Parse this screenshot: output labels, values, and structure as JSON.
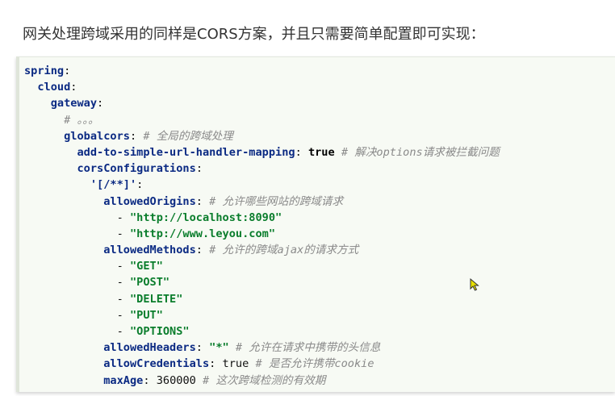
{
  "intro_text": "网关处理跨域采用的同样是CORS方案，并且只需要简单配置即可实现：",
  "code_lines": [
    {
      "indent": "",
      "parts": [
        {
          "t": "spring",
          "c": "k"
        },
        {
          "t": ":",
          "c": "v"
        }
      ]
    },
    {
      "indent": "  ",
      "parts": [
        {
          "t": "cloud",
          "c": "k"
        },
        {
          "t": ":",
          "c": "v"
        }
      ]
    },
    {
      "indent": "    ",
      "parts": [
        {
          "t": "gateway",
          "c": "k"
        },
        {
          "t": ":",
          "c": "v"
        }
      ]
    },
    {
      "indent": "      ",
      "parts": [
        {
          "t": "# 。。。",
          "c": "c"
        }
      ]
    },
    {
      "indent": "      ",
      "parts": [
        {
          "t": "globalcors",
          "c": "k"
        },
        {
          "t": ": ",
          "c": "v"
        },
        {
          "t": "# 全局的跨域处理",
          "c": "c"
        }
      ]
    },
    {
      "indent": "        ",
      "parts": [
        {
          "t": "add-to-simple-url-handler-mapping",
          "c": "k"
        },
        {
          "t": ": ",
          "c": "v"
        },
        {
          "t": "true",
          "c": "b"
        },
        {
          "t": " # 解决options请求被拦截问题",
          "c": "c"
        }
      ]
    },
    {
      "indent": "        ",
      "parts": [
        {
          "t": "corsConfigurations",
          "c": "k"
        },
        {
          "t": ":",
          "c": "v"
        }
      ]
    },
    {
      "indent": "          ",
      "parts": [
        {
          "t": "'[/**]'",
          "c": "k"
        },
        {
          "t": ":",
          "c": "v"
        }
      ]
    },
    {
      "indent": "            ",
      "parts": [
        {
          "t": "allowedOrigins",
          "c": "k"
        },
        {
          "t": ": ",
          "c": "v"
        },
        {
          "t": "# 允许哪些网站的跨域请求",
          "c": "c"
        }
      ]
    },
    {
      "indent": "              ",
      "parts": [
        {
          "t": "- ",
          "c": "v"
        },
        {
          "t": "\"http://localhost:8090\"",
          "c": "s"
        }
      ]
    },
    {
      "indent": "              ",
      "parts": [
        {
          "t": "- ",
          "c": "v"
        },
        {
          "t": "\"http://www.leyou.com\"",
          "c": "s"
        }
      ]
    },
    {
      "indent": "            ",
      "parts": [
        {
          "t": "allowedMethods",
          "c": "k"
        },
        {
          "t": ": ",
          "c": "v"
        },
        {
          "t": "# 允许的跨域ajax的请求方式",
          "c": "c"
        }
      ]
    },
    {
      "indent": "              ",
      "parts": [
        {
          "t": "- ",
          "c": "v"
        },
        {
          "t": "\"GET\"",
          "c": "s"
        }
      ]
    },
    {
      "indent": "              ",
      "parts": [
        {
          "t": "- ",
          "c": "v"
        },
        {
          "t": "\"POST\"",
          "c": "s"
        }
      ]
    },
    {
      "indent": "              ",
      "parts": [
        {
          "t": "- ",
          "c": "v"
        },
        {
          "t": "\"DELETE\"",
          "c": "s"
        }
      ]
    },
    {
      "indent": "              ",
      "parts": [
        {
          "t": "- ",
          "c": "v"
        },
        {
          "t": "\"PUT\"",
          "c": "s"
        }
      ]
    },
    {
      "indent": "              ",
      "parts": [
        {
          "t": "- ",
          "c": "v"
        },
        {
          "t": "\"OPTIONS\"",
          "c": "s"
        }
      ]
    },
    {
      "indent": "            ",
      "parts": [
        {
          "t": "allowedHeaders",
          "c": "k"
        },
        {
          "t": ": ",
          "c": "v"
        },
        {
          "t": "\"*\"",
          "c": "s"
        },
        {
          "t": " # 允许在请求中携带的头信息",
          "c": "c"
        }
      ]
    },
    {
      "indent": "            ",
      "parts": [
        {
          "t": "allowCredentials",
          "c": "k"
        },
        {
          "t": ": ",
          "c": "v"
        },
        {
          "t": "true",
          "c": "v"
        },
        {
          "t": " # 是否允许携带cookie",
          "c": "c"
        }
      ]
    },
    {
      "indent": "            ",
      "parts": [
        {
          "t": "maxAge",
          "c": "k"
        },
        {
          "t": ": ",
          "c": "v"
        },
        {
          "t": "360000",
          "c": "v"
        },
        {
          "t": " # 这次跨域检测的有效期",
          "c": "c"
        }
      ]
    }
  ],
  "colors": {
    "key": "#0b2a83",
    "string": "#0a7d2c",
    "comment": "#8a8a8a",
    "code_background": "#f7faf4",
    "cursor": "#e8e000"
  },
  "icons": {
    "cursor": "mouse-pointer-icon"
  }
}
